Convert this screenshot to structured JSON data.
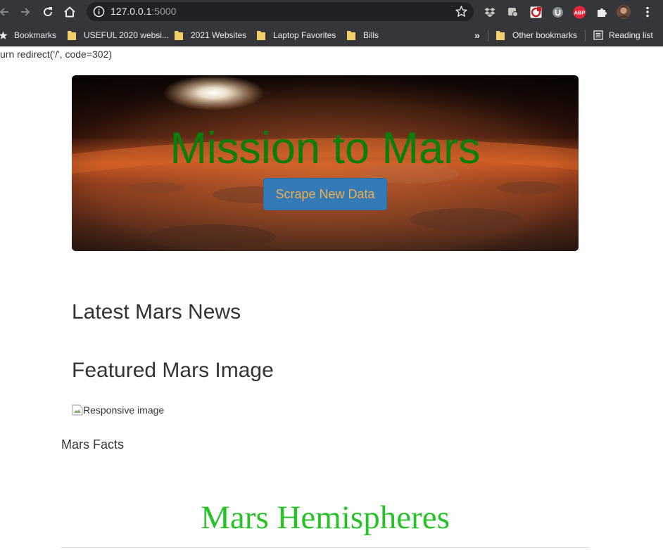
{
  "browser": {
    "url_host": "127.0.0.1",
    "url_port": ":5000",
    "bookmarks": [
      {
        "label": "Bookmarks",
        "type": "star"
      },
      {
        "label": "USEFUL 2020 websi...",
        "type": "folder"
      },
      {
        "label": "2021 Websites",
        "type": "folder"
      },
      {
        "label": "Laptop Favorites",
        "type": "folder"
      },
      {
        "label": "Bills",
        "type": "folder"
      }
    ],
    "overflow_label": "»",
    "other_bookmarks": "Other bookmarks",
    "reading_list": "Reading list",
    "extensions": [
      "dropbox-icon",
      "extension-icon",
      "pocket-icon",
      "ublock-icon",
      "adblock-icon",
      "puzzle-icon",
      "avatar",
      "menu-icon"
    ],
    "adblock_text": "ABP",
    "colors": {
      "toolbar": "#35363a",
      "omnibox": "#202124"
    }
  },
  "page": {
    "debug_text": "urn redirect('/', code=302)",
    "jumbotron": {
      "title": "Mission to Mars",
      "button_label": "Scrape New Data",
      "title_color": "#0a7d0a",
      "button_text_color": "#f0ad4e",
      "button_bg": "#337ab7"
    },
    "latest_news_heading": "Latest Mars News",
    "featured_image_heading": "Featured Mars Image",
    "featured_image_alt": "Responsive image",
    "facts_label": "Mars Facts",
    "hemispheres_heading": "Mars Hemispheres",
    "hemispheres_color": "#27c227"
  }
}
